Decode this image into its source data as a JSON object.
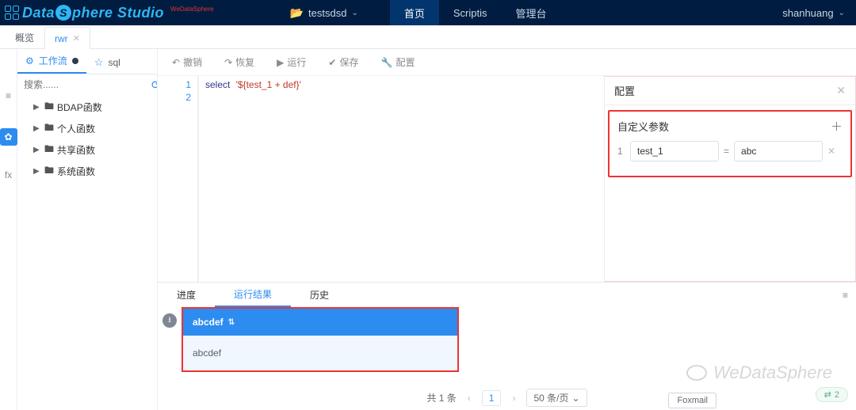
{
  "top": {
    "logo_pre": "Data",
    "logo_s": "S",
    "logo_post": "phere Studio",
    "wedata": "WeDataSphere",
    "project": "testsdsd",
    "nav": {
      "home": "首页",
      "scriptis": "Scriptis",
      "console": "管理台"
    },
    "user": "shanhuang"
  },
  "tabs": {
    "overview": "概览",
    "rwr": "rwr"
  },
  "subtabs": {
    "workflow": "工作流",
    "sql": "sql"
  },
  "search_placeholder": "搜索......",
  "tree": {
    "bdap": "BDAP函数",
    "personal": "个人函数",
    "shared": "共享函数",
    "system": "系统函数"
  },
  "toolbar": {
    "undo": "撤销",
    "redo": "恢复",
    "run": "运行",
    "save": "保存",
    "config": "配置"
  },
  "editor": {
    "ln1": "1",
    "ln2": "2",
    "kw": "select",
    "str": "'${test_1 + def}'"
  },
  "panel": {
    "title": "配置",
    "section": "自定义参数",
    "row_index": "1",
    "key": "test_1",
    "val": "abc"
  },
  "bottom_tabs": {
    "progress": "进度",
    "result": "运行结果",
    "history": "历史"
  },
  "result_col": "abcdef",
  "result_val": "abcdef",
  "pager": {
    "total": "共 1 条",
    "page": "1",
    "size": "50 条/页"
  },
  "foxmail": "Foxmail",
  "watermark": "WeDataSphere",
  "share_count": "2"
}
